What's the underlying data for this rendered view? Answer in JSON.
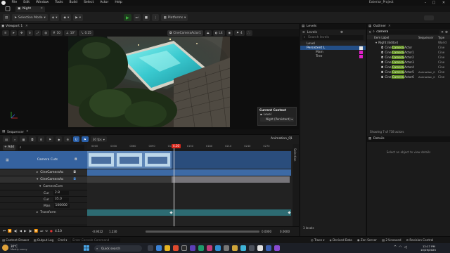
{
  "menubar": {
    "items": [
      "File",
      "Edit",
      "Window",
      "Tools",
      "Build",
      "Select",
      "Actor",
      "Help"
    ],
    "project_title": "Exterior_Project"
  },
  "tabs": {
    "level_tab": "Night"
  },
  "toolbar": {
    "selection_mode": "Selection Mode",
    "platforms": "Platforms"
  },
  "viewport": {
    "title": "Viewport 1",
    "perspective": "Perspective",
    "lit": "Lit",
    "camera_label": "CineCameraActor1",
    "grid_value": "10",
    "angle_value": "10°",
    "scale_value": "0.25",
    "speed_value": "4"
  },
  "current_context": {
    "title": "Current Context",
    "level_label": "Level",
    "level_value": "Night (Persistent)"
  },
  "sequencer": {
    "tab": "Sequencer",
    "add_label": "+ Add",
    "fps": "30 fps",
    "sequence_name": "Animation_01",
    "playhead_frame": "4.10",
    "tracks": {
      "camera_cuts": "Camera Cuts",
      "cine_a": "CineCameraAc",
      "cine_b": "CineCameraAc",
      "camera_com": "CameraCom",
      "cur_label": "Cur",
      "cur_value": "2.8",
      "cur2_label": "Cur",
      "cur2_value": "35.0",
      "man_label": "Man",
      "man_value": "100000",
      "transform": "Transform"
    },
    "ruler_marks": [
      "0000",
      "0030",
      "0060",
      "0090",
      "0120",
      "0150",
      "0180",
      "0210",
      "0240",
      "0270"
    ],
    "bottom": {
      "start": "-0.9022",
      "start2": "1.230",
      "frame": "4.10",
      "end": "0.0000",
      "end2": "0.0000"
    },
    "vertical_tab": "Selection"
  },
  "levels": {
    "tab": "Levels",
    "subtab": "Levels",
    "search_placeholder": "Search levels",
    "header": "Level",
    "rows": [
      "Persistent L",
      "Main",
      "Tree"
    ],
    "footer": "3 levels"
  },
  "outliner": {
    "tab": "Outliner",
    "search_value": "camera",
    "col_item": "Item Label",
    "col_sequence": "Sequencer",
    "col_type": "Type",
    "root": "Night (Editor)",
    "world": "World",
    "rows": [
      {
        "pre": "Cine",
        "hl": "Camera",
        "post": "Actor",
        "type": "Cine"
      },
      {
        "pre": "Cine",
        "hl": "Camera",
        "post": "Actor1",
        "type": "Cine"
      },
      {
        "pre": "Cine",
        "hl": "Camera",
        "post": "Actor2",
        "type": "Cine"
      },
      {
        "pre": "Cine",
        "hl": "Camera",
        "post": "Actor3",
        "type": "Cine"
      },
      {
        "pre": "Cine",
        "hl": "Camera",
        "post": "Actor4",
        "type": "Cine"
      },
      {
        "pre": "Cine",
        "hl": "Camera",
        "post": "Actor5",
        "seq": "Animation_0",
        "type": "Cine"
      },
      {
        "pre": "Cine",
        "hl": "Camera",
        "post": "Actor6",
        "seq": "Animation_0",
        "type": "Cine"
      }
    ],
    "footer": "Showing 7 of 738 actors"
  },
  "details": {
    "tab": "Details",
    "hint": "Select an object to view details"
  },
  "statusbar": {
    "content_drawer": "Content Drawer",
    "output_log": "Output Log",
    "cmd": "Cmd",
    "console_placeholder": "Enter Console Command",
    "trace": "Trace",
    "derived_data": "Derived Data",
    "zen_server": "Zen Server",
    "unsaved": "2 Unsaved",
    "revision": "Revision Control"
  },
  "taskbar": {
    "weather_temp": "30°C",
    "weather_desc": "Mostly sunny",
    "search_placeholder": "Quick search",
    "time": "12:17 PM",
    "date": "10/19/2025"
  },
  "colors": {
    "accent_blue": "#2a7fd6",
    "play_green": "#3fb43f",
    "highlight_green": "#5b8c1a",
    "playhead_red": "#d7261b",
    "track_blue": "#3d6aa5",
    "pool_cyan": "#3fd0d0"
  }
}
